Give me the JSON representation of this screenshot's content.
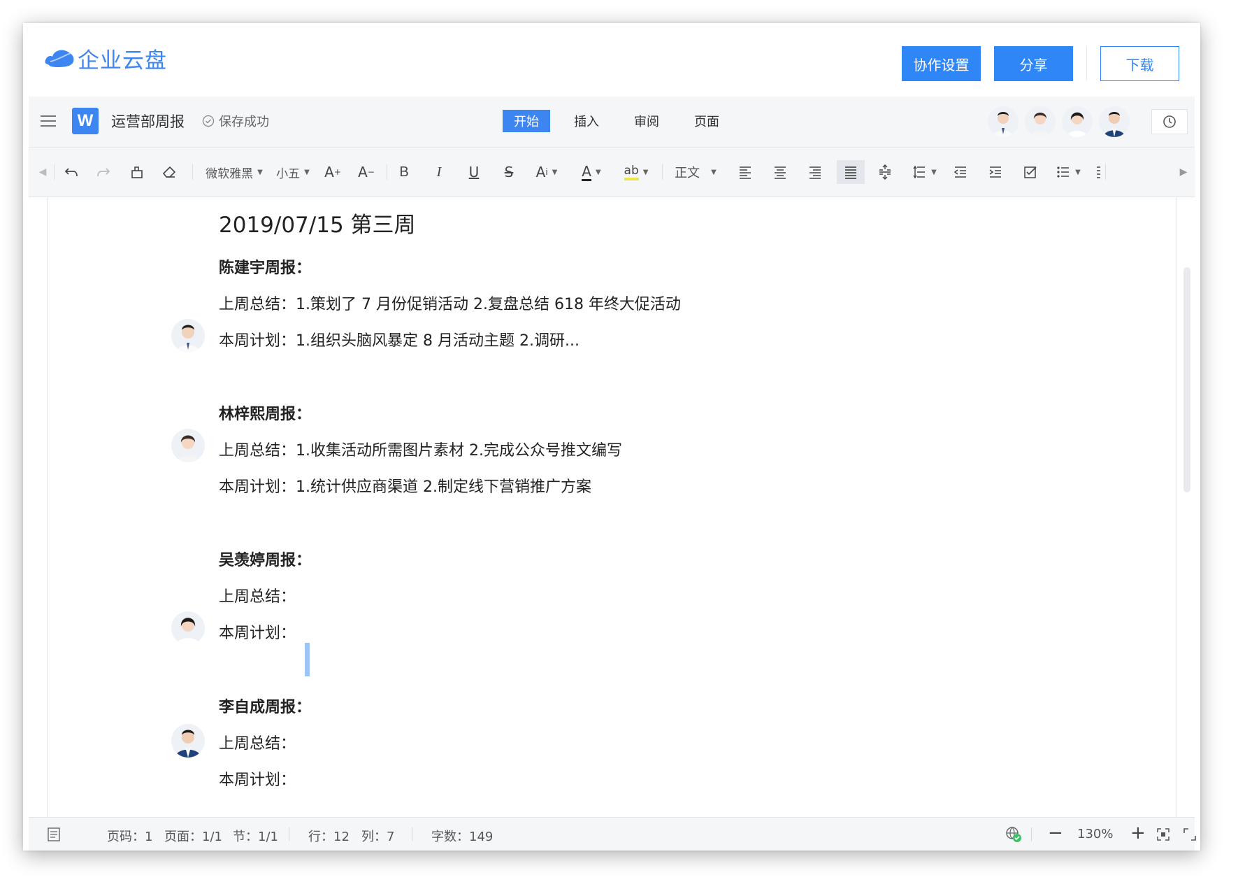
{
  "app": {
    "logo_text": "企业云盘"
  },
  "header": {
    "collab_label": "协作设置",
    "share_label": "分享",
    "download_label": "下载"
  },
  "docbar": {
    "title": "运营部周报",
    "save_status": "保存成功",
    "tabs": [
      {
        "label": "开始",
        "active": true
      },
      {
        "label": "插入",
        "active": false
      },
      {
        "label": "审阅",
        "active": false
      },
      {
        "label": "页面",
        "active": false
      }
    ]
  },
  "toolbar": {
    "font_family": "微软雅黑",
    "font_size": "小五",
    "paragraph_style": "正文",
    "grow_font": "A",
    "shrink_font": "A",
    "bold": "B",
    "italic": "I",
    "underline": "U",
    "strike": "S",
    "font_color": "A",
    "highlight": "ab",
    "text_effect": "A"
  },
  "document": {
    "heading": "2019/07/15  第三周",
    "sections": [
      {
        "title": "陈建宇周报：",
        "last_week": "上周总结：1.策划了 7 月份促销活动  2.复盘总结 618 年终大促活动",
        "this_week": "本周计划：1.组织头脑风暴定 8 月活动主题  2.调研..."
      },
      {
        "title": "林梓熙周报：",
        "last_week": "上周总结：1.收集活动所需图片素材  2.完成公众号推文编写",
        "this_week": "本周计划：1.统计供应商渠道  2.制定线下营销推广方案"
      },
      {
        "title": "吴羡婷周报：",
        "last_week": "上周总结：",
        "this_week": "本周计划："
      },
      {
        "title": "李自成周报：",
        "last_week": "上周总结：",
        "this_week": "本周计划："
      }
    ]
  },
  "status": {
    "page_num": "页码：1",
    "pages": "页面：1/1",
    "section": "节：1/1",
    "row": "行：12",
    "col": "列：7",
    "word_count": "字数：149",
    "zoom": "130%"
  },
  "colors": {
    "accent": "#2f86f6",
    "toolbar_bg": "#f5f6f8"
  }
}
